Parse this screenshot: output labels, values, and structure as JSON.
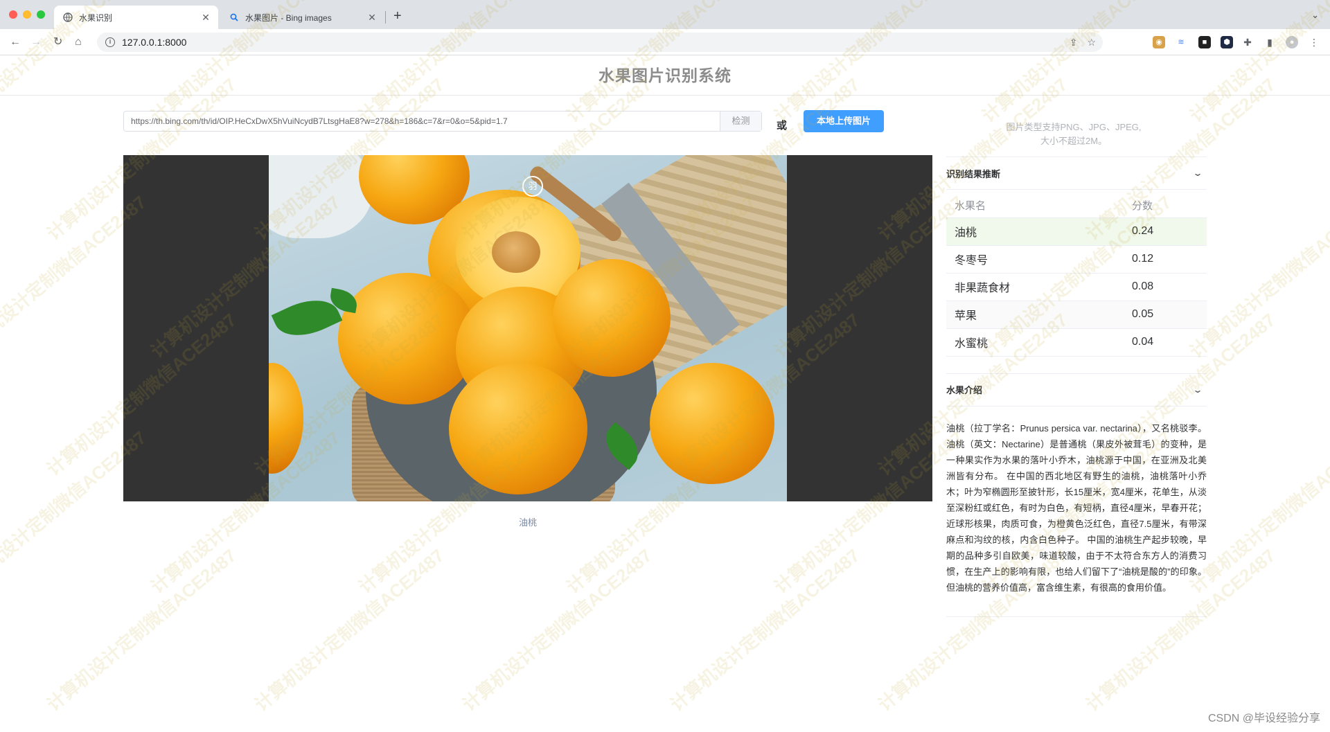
{
  "browser": {
    "tabs": [
      {
        "title": "水果识别",
        "active": true
      },
      {
        "title": "水果图片 - Bing images",
        "active": false
      }
    ],
    "address": "127.0.0.1:8000"
  },
  "app": {
    "title": "水果图片识别系统",
    "url_input_value": "https://th.bing.com/th/id/OIP.HeCxDwX5hVuiNcydB7LtsgHaE8?w=278&h=186&c=7&r=0&o=5&pid=1.7",
    "detect_label": "检测",
    "or_label": "或",
    "upload_label": "本地上传图片",
    "hint_line1": "图片类型支持PNG、JPG、JPEG,",
    "hint_line2": "大小不超过2M。",
    "image_caption": "油桃"
  },
  "results": {
    "section_title": "识别结果推断",
    "col_name": "水果名",
    "col_score": "分数",
    "rows": [
      {
        "name": "油桃",
        "score": "0.24"
      },
      {
        "name": "冬枣号",
        "score": "0.12"
      },
      {
        "name": "非果蔬食材",
        "score": "0.08"
      },
      {
        "name": "苹果",
        "score": "0.05"
      },
      {
        "name": "水蜜桃",
        "score": "0.04"
      }
    ]
  },
  "intro": {
    "section_title": "水果介绍",
    "text": "油桃（拉丁学名：Prunus persica var. nectarina），又名桃驳李。油桃（英文：Nectarine）是普通桃（果皮外被茸毛）的变种，是一种果实作为水果的落叶小乔木，油桃源于中国，在亚洲及北美洲皆有分布。 在中国的西北地区有野生的油桃，油桃落叶小乔木；叶为窄椭圆形至披针形，长15厘米，宽4厘米，花单生，从淡至深粉红或红色，有时为白色，有短柄，直径4厘米，早春开花；近球形核果，肉质可食，为橙黄色泛红色，直径7.5厘米，有带深麻点和沟纹的核，内含白色种子。 中国的油桃生产起步较晚，早期的品种多引自欧美，味道较酸，由于不太符合东方人的消费习惯，在生产上的影响有限，也给人们留下了“油桃是酸的”的印象。但油桃的营养价值高，富含维生素，有很高的食用价值。"
  },
  "watermark_text": "计算机设计定制微信ACE2487",
  "footer_credit": "CSDN @毕设经验分享",
  "colors": {
    "primary": "#409eff",
    "top_row_bg": "#f0f9eb",
    "image_bg": "#333333"
  }
}
